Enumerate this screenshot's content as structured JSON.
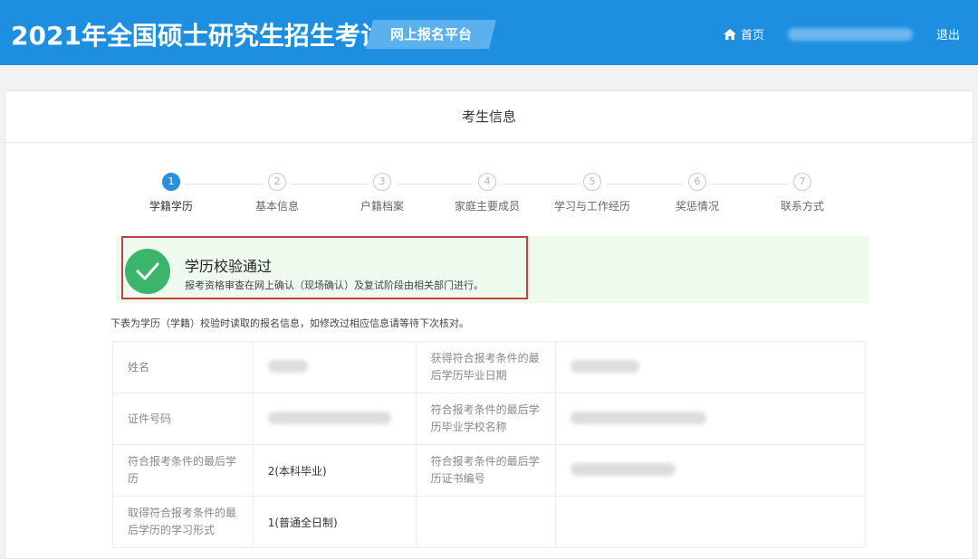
{
  "header": {
    "title": "2021年全国硕士研究生招生考试",
    "platform_tag": "网上报名平台",
    "home_label": "首页",
    "logout_label": "退出"
  },
  "card": {
    "title": "考生信息"
  },
  "steps": [
    {
      "num": "1",
      "label": "学籍学历",
      "active": true
    },
    {
      "num": "2",
      "label": "基本信息",
      "active": false
    },
    {
      "num": "3",
      "label": "户籍档案",
      "active": false
    },
    {
      "num": "4",
      "label": "家庭主要成员",
      "active": false
    },
    {
      "num": "5",
      "label": "学习与工作经历",
      "active": false
    },
    {
      "num": "6",
      "label": "奖惩情况",
      "active": false
    },
    {
      "num": "7",
      "label": "联系方式",
      "active": false
    }
  ],
  "banner": {
    "title": "学历校验通过",
    "desc": "报考资格审查在网上确认（现场确认）及复试阶段由相关部门进行。"
  },
  "table_note": "下表为学历（学籍）校验时读取的报名信息，如修改过相应信息请等待下次核对。",
  "table": {
    "rows": [
      {
        "label1": "姓名",
        "value1": "",
        "label2": "获得符合报考条件的最后学历毕业日期",
        "value2": ""
      },
      {
        "label1": "证件号码",
        "value1": "",
        "label2": "符合报考条件的最后学历毕业学校名称",
        "value2": ""
      },
      {
        "label1": "符合报考条件的最后学历",
        "value1": "2(本科毕业)",
        "label2": "符合报考条件的最后学历证书编号",
        "value2": ""
      },
      {
        "label1": "取得符合报考条件的最后学历的学习形式",
        "value1": "1(普通全日制)",
        "label2": "",
        "value2": ""
      }
    ]
  },
  "colors": {
    "header_bg": "#1e8fe0",
    "active_step": "#2b8fe0",
    "success": "#3bb56b",
    "highlight_outline": "#c3403d"
  }
}
